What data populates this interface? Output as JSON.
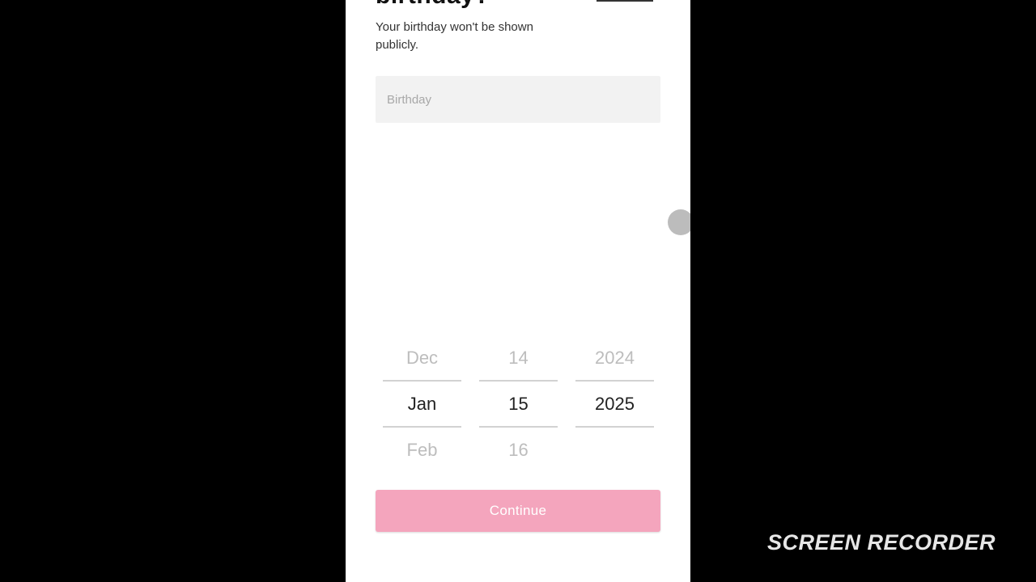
{
  "screen": {
    "heading_partial": "birthday?",
    "subtitle": "Your birthday won't be shown publicly.",
    "birthday_placeholder": "Birthday"
  },
  "date_picker": {
    "month": {
      "above": "Dec",
      "selected": "Jan",
      "below": "Feb"
    },
    "day": {
      "above": "14",
      "selected": "15",
      "below": "16"
    },
    "year": {
      "above": "2024",
      "selected": "2025",
      "below": ""
    }
  },
  "continue_button": {
    "label": "Continue",
    "color": "#f4a5bd"
  },
  "watermark": "SCREEN RECORDER"
}
